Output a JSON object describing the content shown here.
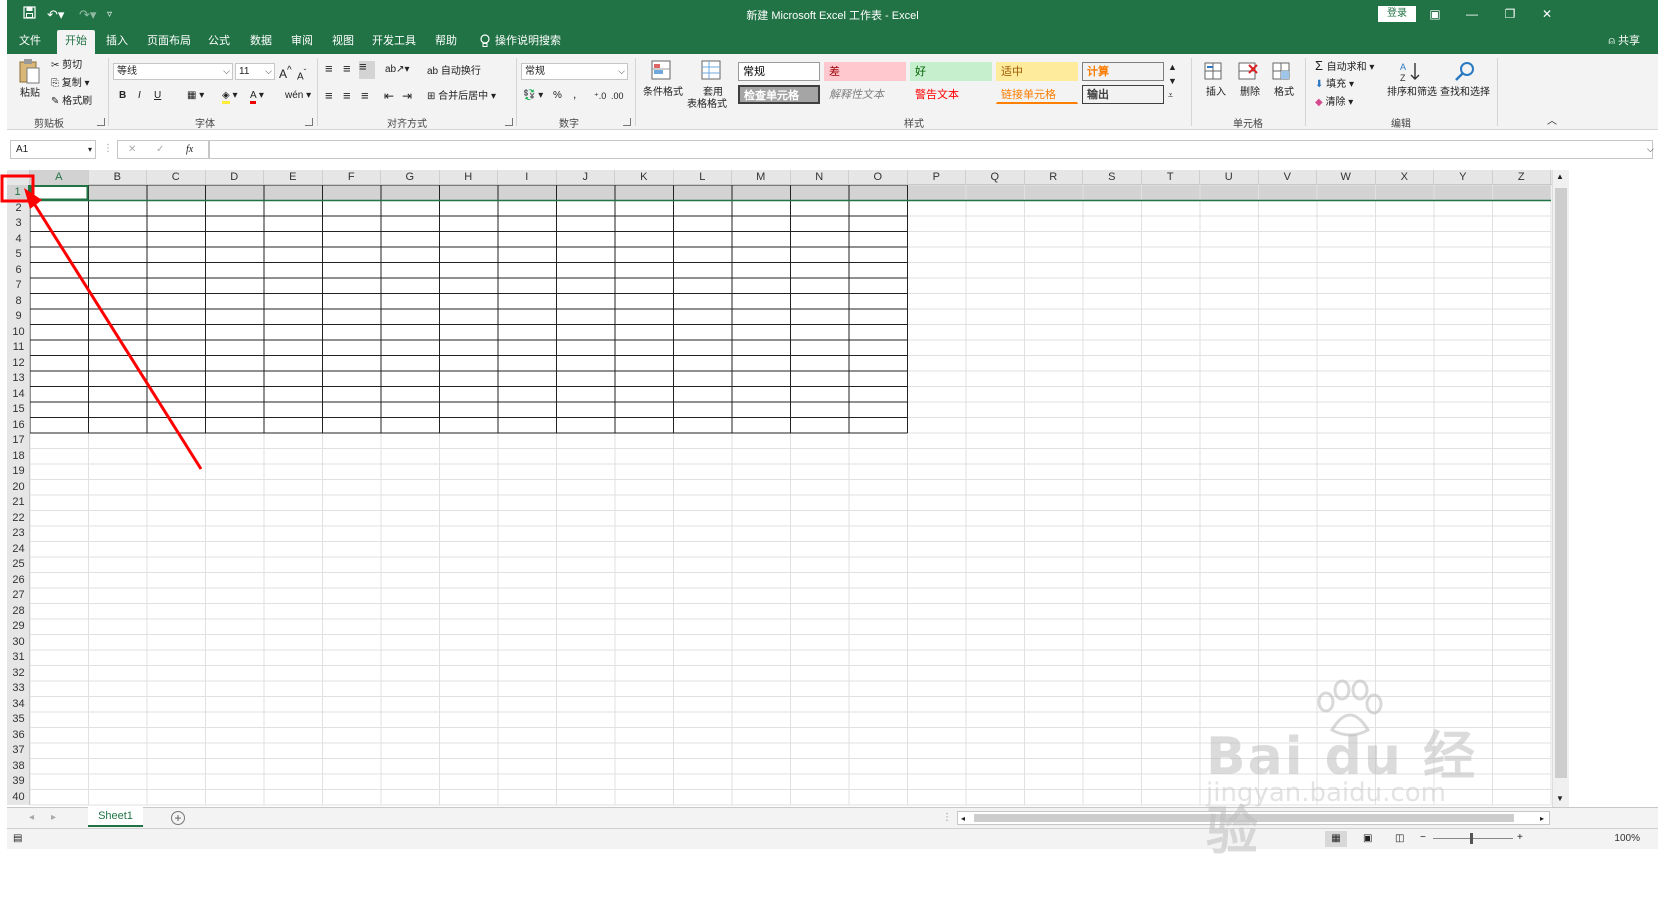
{
  "app": {
    "title": "新建 Microsoft Excel 工作表  -  Excel",
    "login": "登录",
    "share": "共享",
    "colors": {
      "accent": "#217346",
      "ribbon_bg": "#f3f3f3",
      "annotation": "#ff0000"
    }
  },
  "tabs": [
    "文件",
    "开始",
    "插入",
    "页面布局",
    "公式",
    "数据",
    "审阅",
    "视图",
    "开发工具",
    "帮助",
    "操作说明搜索"
  ],
  "active_tab": "开始",
  "ribbon": {
    "clipboard": {
      "paste": "粘贴",
      "cut": "剪切",
      "copy": "复制",
      "format_painter": "格式刷",
      "label": "剪贴板"
    },
    "font": {
      "name": "等线",
      "size": "11",
      "bold": "B",
      "italic": "I",
      "underline": "U",
      "grow": "A",
      "shrink": "A",
      "label": "字体"
    },
    "alignment": {
      "wrap": "自动换行",
      "merge": "合并后居中",
      "label": "对齐方式"
    },
    "number": {
      "format": "常规",
      "percent": "%",
      "comma": ",",
      "label": "数字"
    },
    "styles": {
      "conditional": "条件格式",
      "table_format_1": "套用",
      "table_format_2": "表格格式",
      "cells": [
        "常规",
        "差",
        "好",
        "适中",
        "计算",
        "检查单元格",
        "解释性文本",
        "警告文本",
        "链接单元格",
        "输出"
      ],
      "label": "样式"
    },
    "cells_group": {
      "insert": "插入",
      "delete": "删除",
      "format": "格式",
      "label": "单元格"
    },
    "editing": {
      "autosum": "自动求和",
      "fill": "填充",
      "clear": "清除",
      "sort": "排序和筛选",
      "find": "查找和选择",
      "label": "编辑"
    }
  },
  "formula_bar": {
    "name_box": "A1",
    "fx": "fx",
    "value": ""
  },
  "grid": {
    "columns": [
      "A",
      "B",
      "C",
      "D",
      "E",
      "F",
      "G",
      "H",
      "I",
      "J",
      "K",
      "L",
      "M",
      "N",
      "O",
      "P",
      "Q",
      "R",
      "S",
      "T",
      "U",
      "V",
      "W",
      "X",
      "Y",
      "Z"
    ],
    "rows": [
      "1",
      "2",
      "3",
      "4",
      "5",
      "6",
      "7",
      "8",
      "9",
      "10",
      "11",
      "12",
      "13",
      "14",
      "15",
      "16",
      "17",
      "18",
      "19",
      "20",
      "21",
      "22",
      "23",
      "24",
      "25",
      "26",
      "27",
      "28",
      "29",
      "30",
      "31",
      "32",
      "33",
      "34",
      "35",
      "36",
      "37",
      "38",
      "39",
      "40"
    ],
    "selected_cell": "A1",
    "selected_row": "1",
    "bordered_range": "A1:O16"
  },
  "sheets": [
    "Sheet1"
  ],
  "status": {
    "zoom": "100%"
  },
  "watermark": {
    "main": "Bai du 经验",
    "sub": "jingyan.baidu.com"
  }
}
